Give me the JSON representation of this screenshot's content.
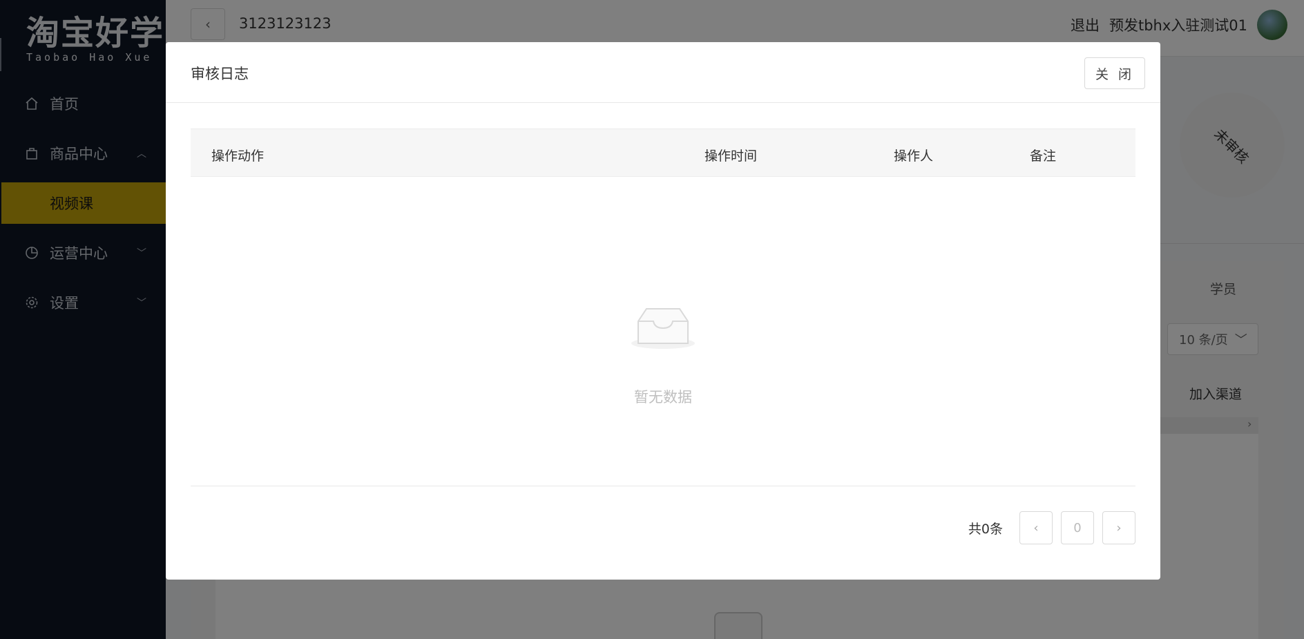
{
  "sidebar": {
    "logo_cn": "淘宝好学",
    "logo_en": "Taobao Hao Xue",
    "items": [
      {
        "label": "首页",
        "icon": "home-icon"
      },
      {
        "label": "商品中心",
        "icon": "bag-icon",
        "expanded": true
      },
      {
        "label": "视频课",
        "active": true
      },
      {
        "label": "运营中心",
        "icon": "pie-chart-icon"
      },
      {
        "label": "设置",
        "icon": "gear-icon"
      }
    ]
  },
  "header": {
    "title": "3123123123",
    "logout": "退出",
    "username": "预发tbhx入驻测试01"
  },
  "background": {
    "status": "未审核",
    "students_label": "学员",
    "page_size": "10 条/页",
    "add_channel": "加入渠道"
  },
  "modal": {
    "title": "审核日志",
    "close_label": "关 闭",
    "columns": [
      "操作动作",
      "操作时间",
      "操作人",
      "备注"
    ],
    "rows": [],
    "empty_text": "暂无数据",
    "pagination": {
      "total_text": "共0条",
      "current_page": "0"
    }
  },
  "colors": {
    "sidebar_bg": "#0e1625",
    "active_item_bg": "#c4a40a",
    "overlay": "rgba(0,0,0,0.5)"
  }
}
